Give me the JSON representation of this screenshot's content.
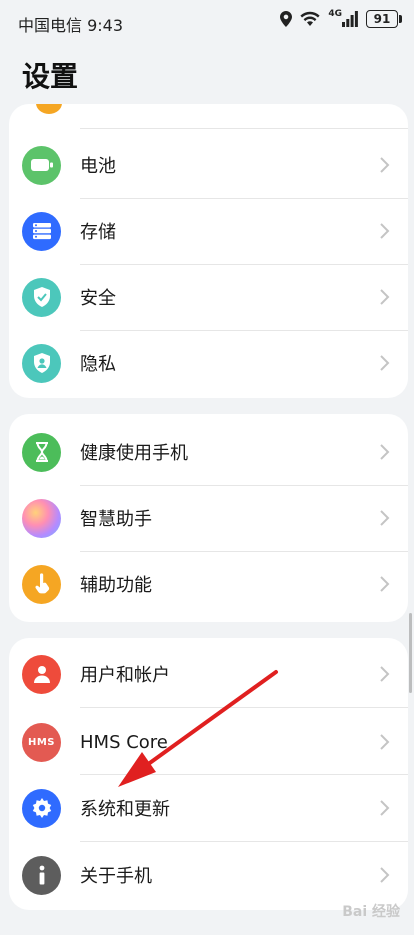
{
  "status_bar": {
    "carrier_time": "中国电信 9:43",
    "network": "4G",
    "battery": "91"
  },
  "header": {
    "title": "设置"
  },
  "groups": [
    {
      "items": [
        {
          "label": "电池",
          "icon": "battery-icon",
          "color": "#5cc36a"
        },
        {
          "label": "存储",
          "icon": "storage-icon",
          "color": "#2f6bff"
        },
        {
          "label": "安全",
          "icon": "shield-icon",
          "color": "#4cc7bb"
        },
        {
          "label": "隐私",
          "icon": "privacy-icon",
          "color": "#4cc7bb"
        }
      ]
    },
    {
      "items": [
        {
          "label": "健康使用手机",
          "icon": "hourglass-icon",
          "color": "#4cbd5a"
        },
        {
          "label": "智慧助手",
          "icon": "assistant-orb-icon",
          "color": "#c58bff"
        },
        {
          "label": "辅助功能",
          "icon": "hand-icon",
          "color": "#f5a623"
        }
      ]
    },
    {
      "items": [
        {
          "label": "用户和帐户",
          "icon": "user-icon",
          "color": "#ee4b3b"
        },
        {
          "label": "HMS Core",
          "icon": "hms-icon",
          "color": "#e35a52",
          "icon_text": "HMS"
        },
        {
          "label": "系统和更新",
          "icon": "gear-icon",
          "color": "#2f6bff"
        },
        {
          "label": "关于手机",
          "icon": "info-icon",
          "color": "#5d5d5d"
        }
      ]
    }
  ],
  "annotation": {
    "type": "red-arrow",
    "color": "#e02020"
  },
  "watermark": "Bai 经验"
}
